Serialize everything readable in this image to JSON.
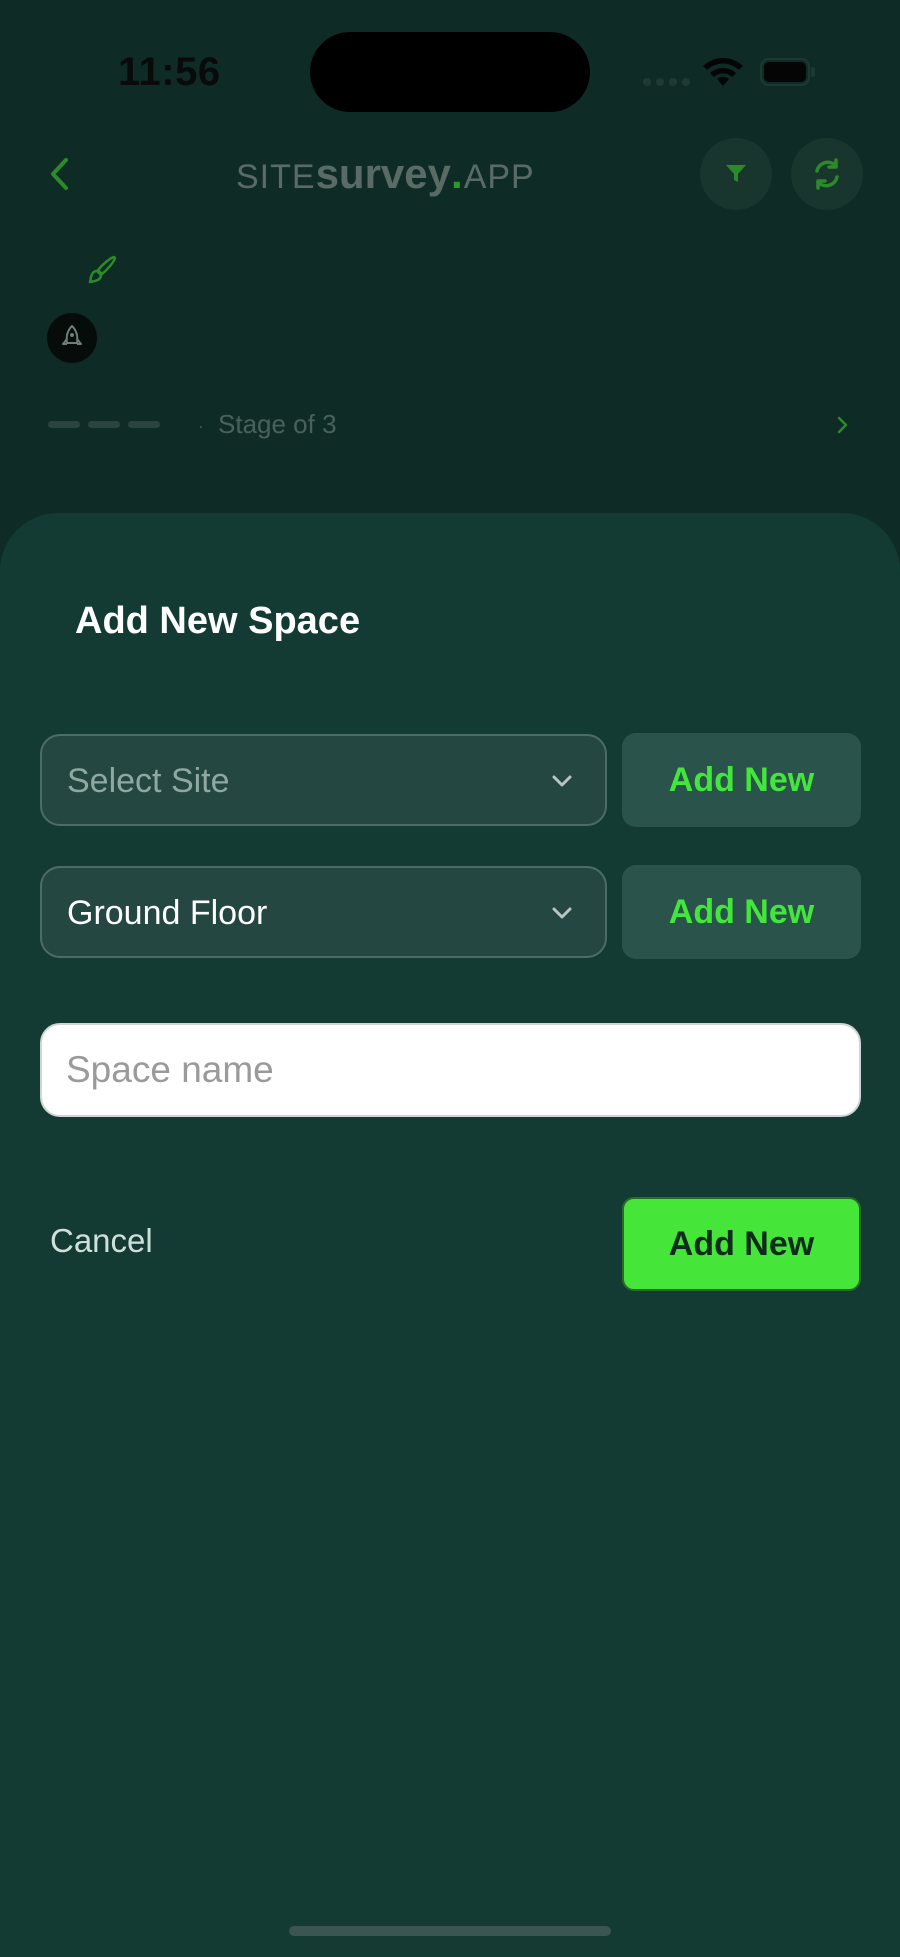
{
  "status_bar": {
    "time": "11:56"
  },
  "header": {
    "logo": {
      "part1": "SITE",
      "part2": "survey",
      "part3": ".",
      "part4": "APP"
    },
    "icons": {
      "back": "chevron-left-icon",
      "filter": "filter-icon",
      "refresh": "refresh-icon"
    }
  },
  "background_page": {
    "stage_label": "Stage  of 3",
    "icons": {
      "brush": "brush-icon",
      "rocket": "rocket-icon"
    }
  },
  "sheet": {
    "title": "Add New Space",
    "site_select": {
      "value": "Select Site",
      "add_label": "Add New"
    },
    "floor_select": {
      "value": "Ground Floor",
      "add_label": "Add New"
    },
    "space_input": {
      "placeholder": "Space name",
      "value": ""
    },
    "cancel_label": "Cancel",
    "submit_label": "Add New"
  },
  "colors": {
    "accent": "#45e53a",
    "sheet_bg": "#133b33",
    "page_bg": "#0f2b25"
  }
}
